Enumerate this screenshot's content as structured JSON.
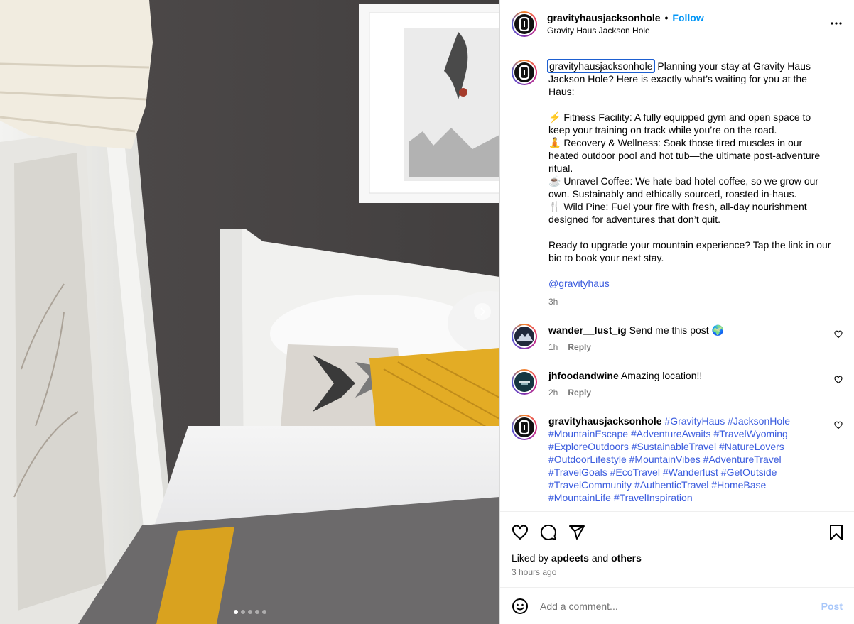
{
  "post": {
    "username": "gravityhausjacksonhole",
    "separator": "•",
    "follow_label": "Follow",
    "subtitle": "Gravity Haus Jackson Hole",
    "caption_user": "gravityhausjacksonhole",
    "caption_text": "Planning your stay at Gravity Haus Jackson Hole? Here is exactly what’s waiting for you at the Haus:\n\n⚡ Fitness Facility: A fully equipped gym and open space to keep your training on track while you’re on the road.\n🧘 Recovery & Wellness: Soak those tired muscles in our heated outdoor pool and hot tub—the ultimate post-adventure ritual.\n☕ Unravel Coffee: We hate bad hotel coffee, so we grow our own. Sustainably and ethically sourced, roasted in-haus.\n🍴 Wild Pine: Fuel your fire with fresh, all-day nourishment designed for adventures that don’t quit.\n\nReady to upgrade your mountain experience? Tap the link in our bio to book your next stay.",
    "mention": "@gravityhaus",
    "caption_time": "3h"
  },
  "comments": [
    {
      "user": "wander__lust_ig",
      "text": "Send me this post 🌍",
      "time": "1h",
      "reply": "Reply"
    },
    {
      "user": "jhfoodandwine",
      "text": "Amazing location!!",
      "time": "2h",
      "reply": "Reply"
    },
    {
      "user": "gravityhausjacksonhole",
      "tags": [
        "#GravityHaus",
        "#JacksonHole",
        "#MountainEscape",
        "#AdventureAwaits",
        "#TravelWyoming",
        "#ExploreOutdoors",
        "#SustainableTravel",
        "#NatureLovers",
        "#OutdoorLifestyle",
        "#MountainVibes",
        "#AdventureTravel",
        "#TravelGoals",
        "#EcoTravel",
        "#Wanderlust",
        "#GetOutside",
        "#TravelCommunity",
        "#AuthenticTravel",
        "#HomeBase",
        "#MountainLife",
        "#TravelInspiration"
      ]
    }
  ],
  "likes": {
    "prefix": "Liked by",
    "user": "apdeets",
    "middle": "and",
    "others": "others"
  },
  "posted_ago": "3 hours ago",
  "add_comment": {
    "placeholder": "Add a comment...",
    "post_label": "Post"
  },
  "carousel": {
    "count": 5,
    "active_index": 0
  },
  "colors": {
    "link": "#3b5cde",
    "follow": "#0095f6",
    "post_disabled": "#a8c7fa",
    "muted": "#737373"
  },
  "icons": [
    "more-icon",
    "heart-icon",
    "comment-icon",
    "share-icon",
    "bookmark-icon",
    "emoji-icon",
    "chevron-right-icon"
  ]
}
